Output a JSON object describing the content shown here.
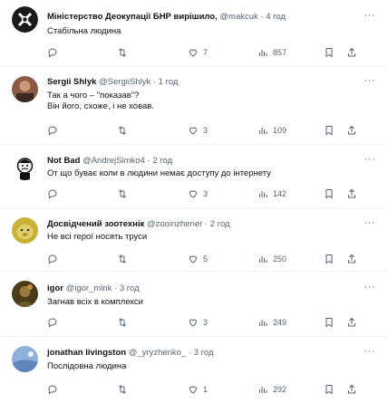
{
  "colors": {
    "text": "#0f1419",
    "muted": "#536471",
    "divider": "#eff3f4"
  },
  "more_glyph": "···",
  "tweets": [
    {
      "name": "Міністерство Деокупації БНР вирішило,",
      "handle": "@makcuk",
      "sep": "·",
      "time": "4 год",
      "text": "Стабільна людина",
      "likes": "7",
      "views": "857"
    },
    {
      "name": "Sergii Shlyk",
      "handle": "@SergiiShlyk",
      "sep": "·",
      "time": "1 год",
      "text": "Так а чого – \"показав\"?\nВін його, схоже, і не ховав.",
      "likes": "3",
      "views": "109"
    },
    {
      "name": "Not Bad",
      "handle": "@AndrejSimko4",
      "sep": "·",
      "time": "2 год",
      "text": "От що буває коли в людини немає доступу до інтернету",
      "likes": "3",
      "views": "142"
    },
    {
      "name": "Досвідчений зоотехнік",
      "handle": "@zooinzhener",
      "sep": "·",
      "time": "2 год",
      "text": "Не всі герої носять труси",
      "likes": "5",
      "views": "250"
    },
    {
      "name": "igor",
      "handle": "@igor_mlnk",
      "sep": "·",
      "time": "3 год",
      "text": "Загнав всіх в комплекси",
      "likes": "3",
      "views": "249"
    },
    {
      "name": "jonathan livingston",
      "handle": "@_yryzhenko_",
      "sep": "·",
      "time": "3 год",
      "text": "Послідовна людина",
      "likes": "1",
      "views": "292"
    }
  ]
}
